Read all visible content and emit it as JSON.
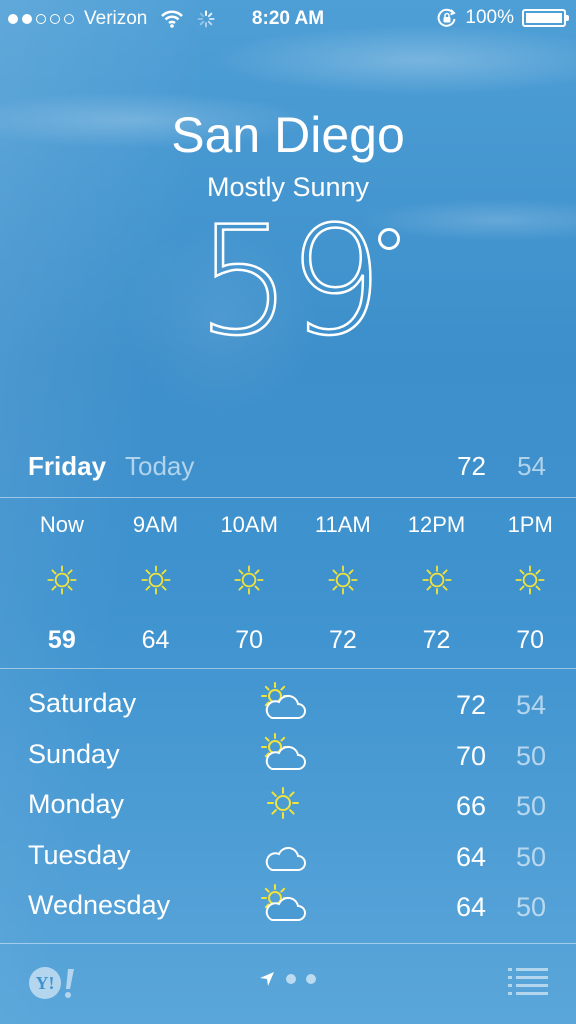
{
  "status_bar": {
    "carrier": "Verizon",
    "time": "8:20 AM",
    "battery": "100%",
    "battery_level": 1.0,
    "signal_bars_filled": 2,
    "signal_bars_total": 5
  },
  "header": {
    "city": "San Diego",
    "condition": "Mostly Sunny",
    "temperature": "59"
  },
  "today": {
    "day": "Friday",
    "label": "Today",
    "high": "72",
    "low": "54"
  },
  "hourly": [
    {
      "time": "Now",
      "icon": "sun-icon",
      "temp": "59"
    },
    {
      "time": "9AM",
      "icon": "sun-icon",
      "temp": "64"
    },
    {
      "time": "10AM",
      "icon": "sun-icon",
      "temp": "70"
    },
    {
      "time": "11AM",
      "icon": "sun-icon",
      "temp": "72"
    },
    {
      "time": "12PM",
      "icon": "sun-icon",
      "temp": "72"
    },
    {
      "time": "1PM",
      "icon": "sun-icon",
      "temp": "70"
    }
  ],
  "daily": [
    {
      "day": "Saturday",
      "icon": "partly-cloudy-icon",
      "high": "72",
      "low": "54"
    },
    {
      "day": "Sunday",
      "icon": "partly-cloudy-icon",
      "high": "70",
      "low": "50"
    },
    {
      "day": "Monday",
      "icon": "sun-icon",
      "high": "66",
      "low": "50"
    },
    {
      "day": "Tuesday",
      "icon": "cloud-icon",
      "high": "64",
      "low": "50"
    },
    {
      "day": "Wednesday",
      "icon": "partly-cloudy-icon",
      "high": "64",
      "low": "50"
    }
  ],
  "footer": {
    "logo_text": "Y!",
    "page_count": 2
  },
  "colors": {
    "sun": "#f2e33a",
    "background_top": "#4e9fd6",
    "background_bottom": "#5aa6da"
  }
}
